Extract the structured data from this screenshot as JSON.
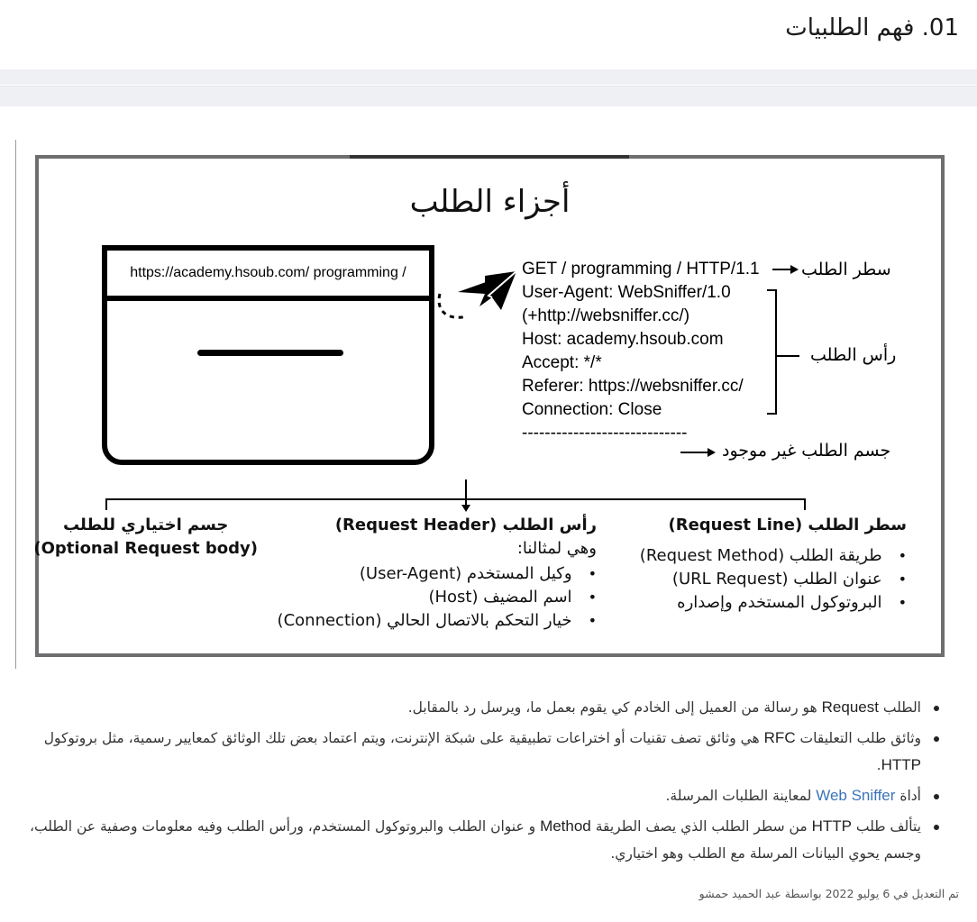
{
  "page": {
    "title": "01. فهم الطلبيات"
  },
  "figure": {
    "title": "أجزاء الطلب",
    "browser_url": "https://academy.hsoub.com/ programming /",
    "http_lines": [
      "GET / programming / HTTP/1.1",
      "User-Agent: WebSniffer/1.0",
      "(+http://websniffer.cc/)",
      "Host: academy.hsoub.com",
      "Accept: */*",
      "Referer: https://websniffer.cc/",
      "Connection: Close",
      "-----------------------------"
    ],
    "labels": {
      "request_line": "سطر الطلب",
      "request_header": "رأس الطلب",
      "request_body_missing": "جسم الطلب غير موجود"
    },
    "columns": {
      "request_line": {
        "title": "سطر الطلب (Request Line)",
        "items": [
          "طريقة الطلب (Request Method)",
          "عنوان الطلب (URL Request)",
          "البروتوكول المستخدم وإصداره"
        ]
      },
      "request_header": {
        "title": "رأس الطلب (Request Header)",
        "subtitle": "وهي لمثالنا:",
        "items": [
          "وكيل المستخدم (User-Agent)",
          "اسم المضيف (Host)",
          "خيار التحكم بالاتصال الحالي (Connection)"
        ]
      },
      "request_body": {
        "title_line1": "جسم اختياري للطلب",
        "title_line2": "(Optional Request body)"
      }
    }
  },
  "notes": {
    "n1": {
      "a": "الطلب ",
      "en": "Request",
      "b": " هو رسالة من العميل إلى الخادم كي يقوم بعمل ما، ويرسل رد بالمقابل."
    },
    "n2": {
      "a": "وثائق طلب التعليقات ",
      "en": "RFC",
      "b": " هي وثائق تصف تقنيات أو اختراعات تطبيقية على شبكة الإنترنت، ويتم اعتماد بعض تلك الوثائق كمعايير رسمية، مثل بروتوكول ",
      "en2": "HTTP",
      "c": "."
    },
    "n3": {
      "a": "أداة ",
      "link": "Web Sniffer",
      "b": " لمعاينة الطلبات المرسلة."
    },
    "n4": {
      "a": "يتألف طلب ",
      "en": "HTTP",
      "b": " من سطر الطلب الذي يصف الطريقة ",
      "en2": "Method",
      "c": " و عنوان الطلب والبروتوكول المستخدم، ورأس الطلب وفيه معلومات وصفية عن الطلب، وجسم يحوي البيانات المرسلة مع الطلب وهو اختياري."
    }
  },
  "edit_note": {
    "prefix": "تم التعديل في ",
    "date": "6 يوليو 2022",
    "suffix": " بواسطة عبد الحميد حمشو"
  }
}
